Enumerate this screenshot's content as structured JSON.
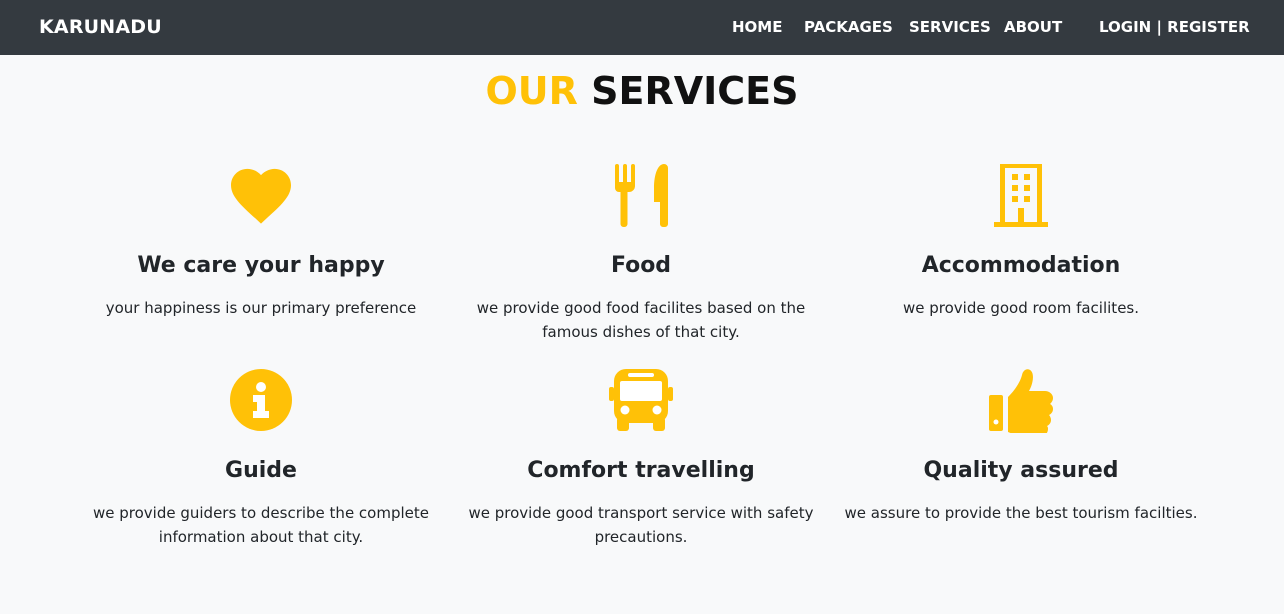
{
  "navbar": {
    "brand": "KARUNADU",
    "links": [
      "HOME",
      "PACKAGES",
      "SERVICES",
      "ABOUT",
      "LOGIN | REGISTER"
    ]
  },
  "section": {
    "title_accent": "OUR",
    "title_main": "SERVICES"
  },
  "services": [
    {
      "icon": "heart-icon",
      "title": "We care your happy",
      "text": "your happiness is our primary preference"
    },
    {
      "icon": "utensils-icon",
      "title": "Food",
      "text": "we provide good food facilites based on the famous dishes of that city."
    },
    {
      "icon": "building-icon",
      "title": "Accommodation",
      "text": "we provide good room facilites."
    },
    {
      "icon": "info-icon",
      "title": "Guide",
      "text": "we provide guiders to describe the complete information about that city."
    },
    {
      "icon": "bus-icon",
      "title": "Comfort travelling",
      "text": "we provide good transport service with safety precautions."
    },
    {
      "icon": "thumbs-up-icon",
      "title": "Quality assured",
      "text": "we assure to provide the best tourism facilties."
    }
  ],
  "colors": {
    "accent": "#ffc107",
    "navbar": "#343a40",
    "background": "#f8f9fa"
  }
}
